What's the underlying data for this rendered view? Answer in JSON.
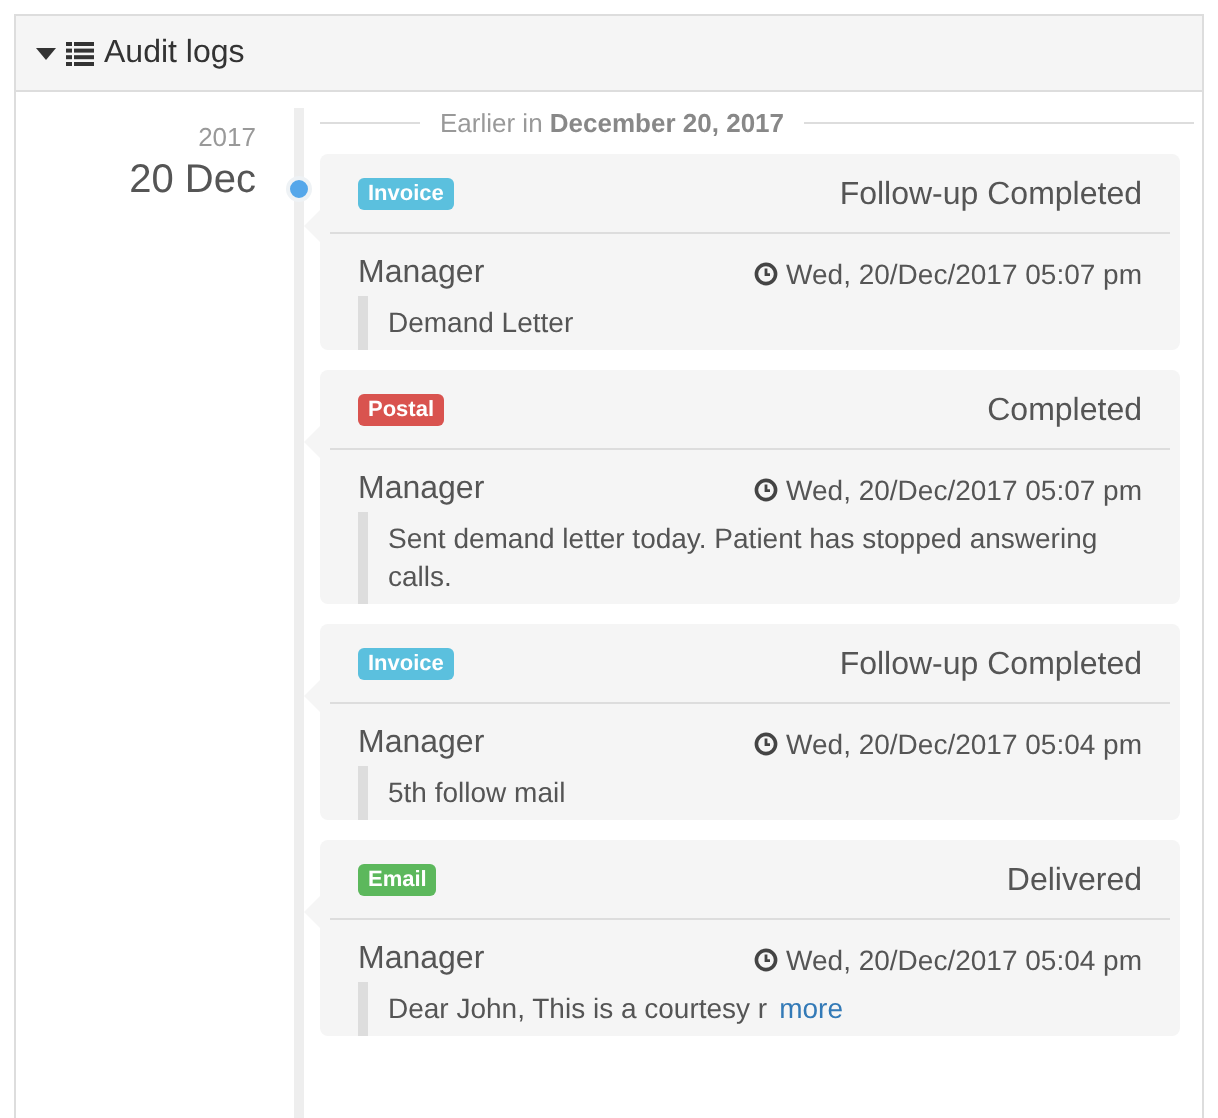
{
  "panel": {
    "title": "Audit logs"
  },
  "timeline": {
    "year": "2017",
    "day": "20 Dec",
    "divider": {
      "prefix": "Earlier in",
      "date": "December 20, 2017"
    },
    "entries": [
      {
        "tag": "Invoice",
        "color": "#5bc0de",
        "status": "Follow-up Completed",
        "author": "Manager",
        "time": "Wed, 20/Dec/2017 05:07 pm",
        "note": "Demand Letter"
      },
      {
        "tag": "Postal",
        "color": "#d9534f",
        "status": "Completed",
        "author": "Manager",
        "time": "Wed, 20/Dec/2017 05:07 pm",
        "note": "Sent demand letter today. Patient has stopped answering calls."
      },
      {
        "tag": "Invoice",
        "color": "#5bc0de",
        "status": "Follow-up Completed",
        "author": "Manager",
        "time": "Wed, 20/Dec/2017 05:04 pm",
        "note": "5th follow mail"
      },
      {
        "tag": "Email",
        "color": "#5cb85c",
        "status": "Delivered",
        "author": "Manager",
        "time": "Wed, 20/Dec/2017 05:04 pm",
        "note": "Dear John, This is a courtesy r",
        "link": "more"
      }
    ]
  }
}
